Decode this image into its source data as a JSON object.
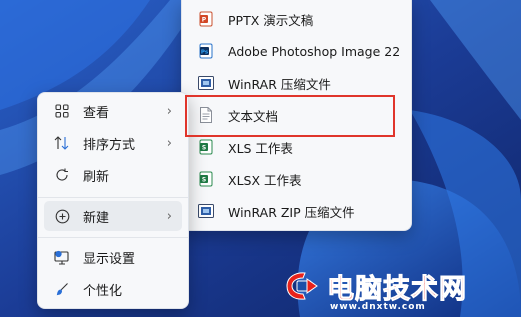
{
  "context_menu": {
    "items": [
      {
        "label": "查看",
        "icon": "grid-icon"
      },
      {
        "label": "排序方式",
        "icon": "sort-icon"
      },
      {
        "label": "刷新",
        "icon": "refresh-icon"
      },
      {
        "label": "新建",
        "icon": "add-circle-icon"
      },
      {
        "label": "显示设置",
        "icon": "display-settings-icon"
      },
      {
        "label": "个性化",
        "icon": "brush-icon"
      }
    ]
  },
  "new_submenu": {
    "items": [
      {
        "label": "PPTX 演示文稿",
        "icon": "pptx-icon"
      },
      {
        "label": "Adobe Photoshop Image 22",
        "icon": "photoshop-icon"
      },
      {
        "label": "WinRAR 压缩文件",
        "icon": "winrar-icon"
      },
      {
        "label": "文本文档",
        "icon": "text-document-icon"
      },
      {
        "label": "XLS 工作表",
        "icon": "xls-icon"
      },
      {
        "label": "XLSX 工作表",
        "icon": "xlsx-icon"
      },
      {
        "label": "WinRAR ZIP 压缩文件",
        "icon": "winrar-zip-icon"
      }
    ]
  },
  "watermark": {
    "text": "电脑技术网",
    "url": "www.dnxtw.com"
  },
  "colors": {
    "highlight": "#e0352b",
    "wallpaper": "#1d3f95",
    "menu_bg": "#f7f8fa"
  }
}
